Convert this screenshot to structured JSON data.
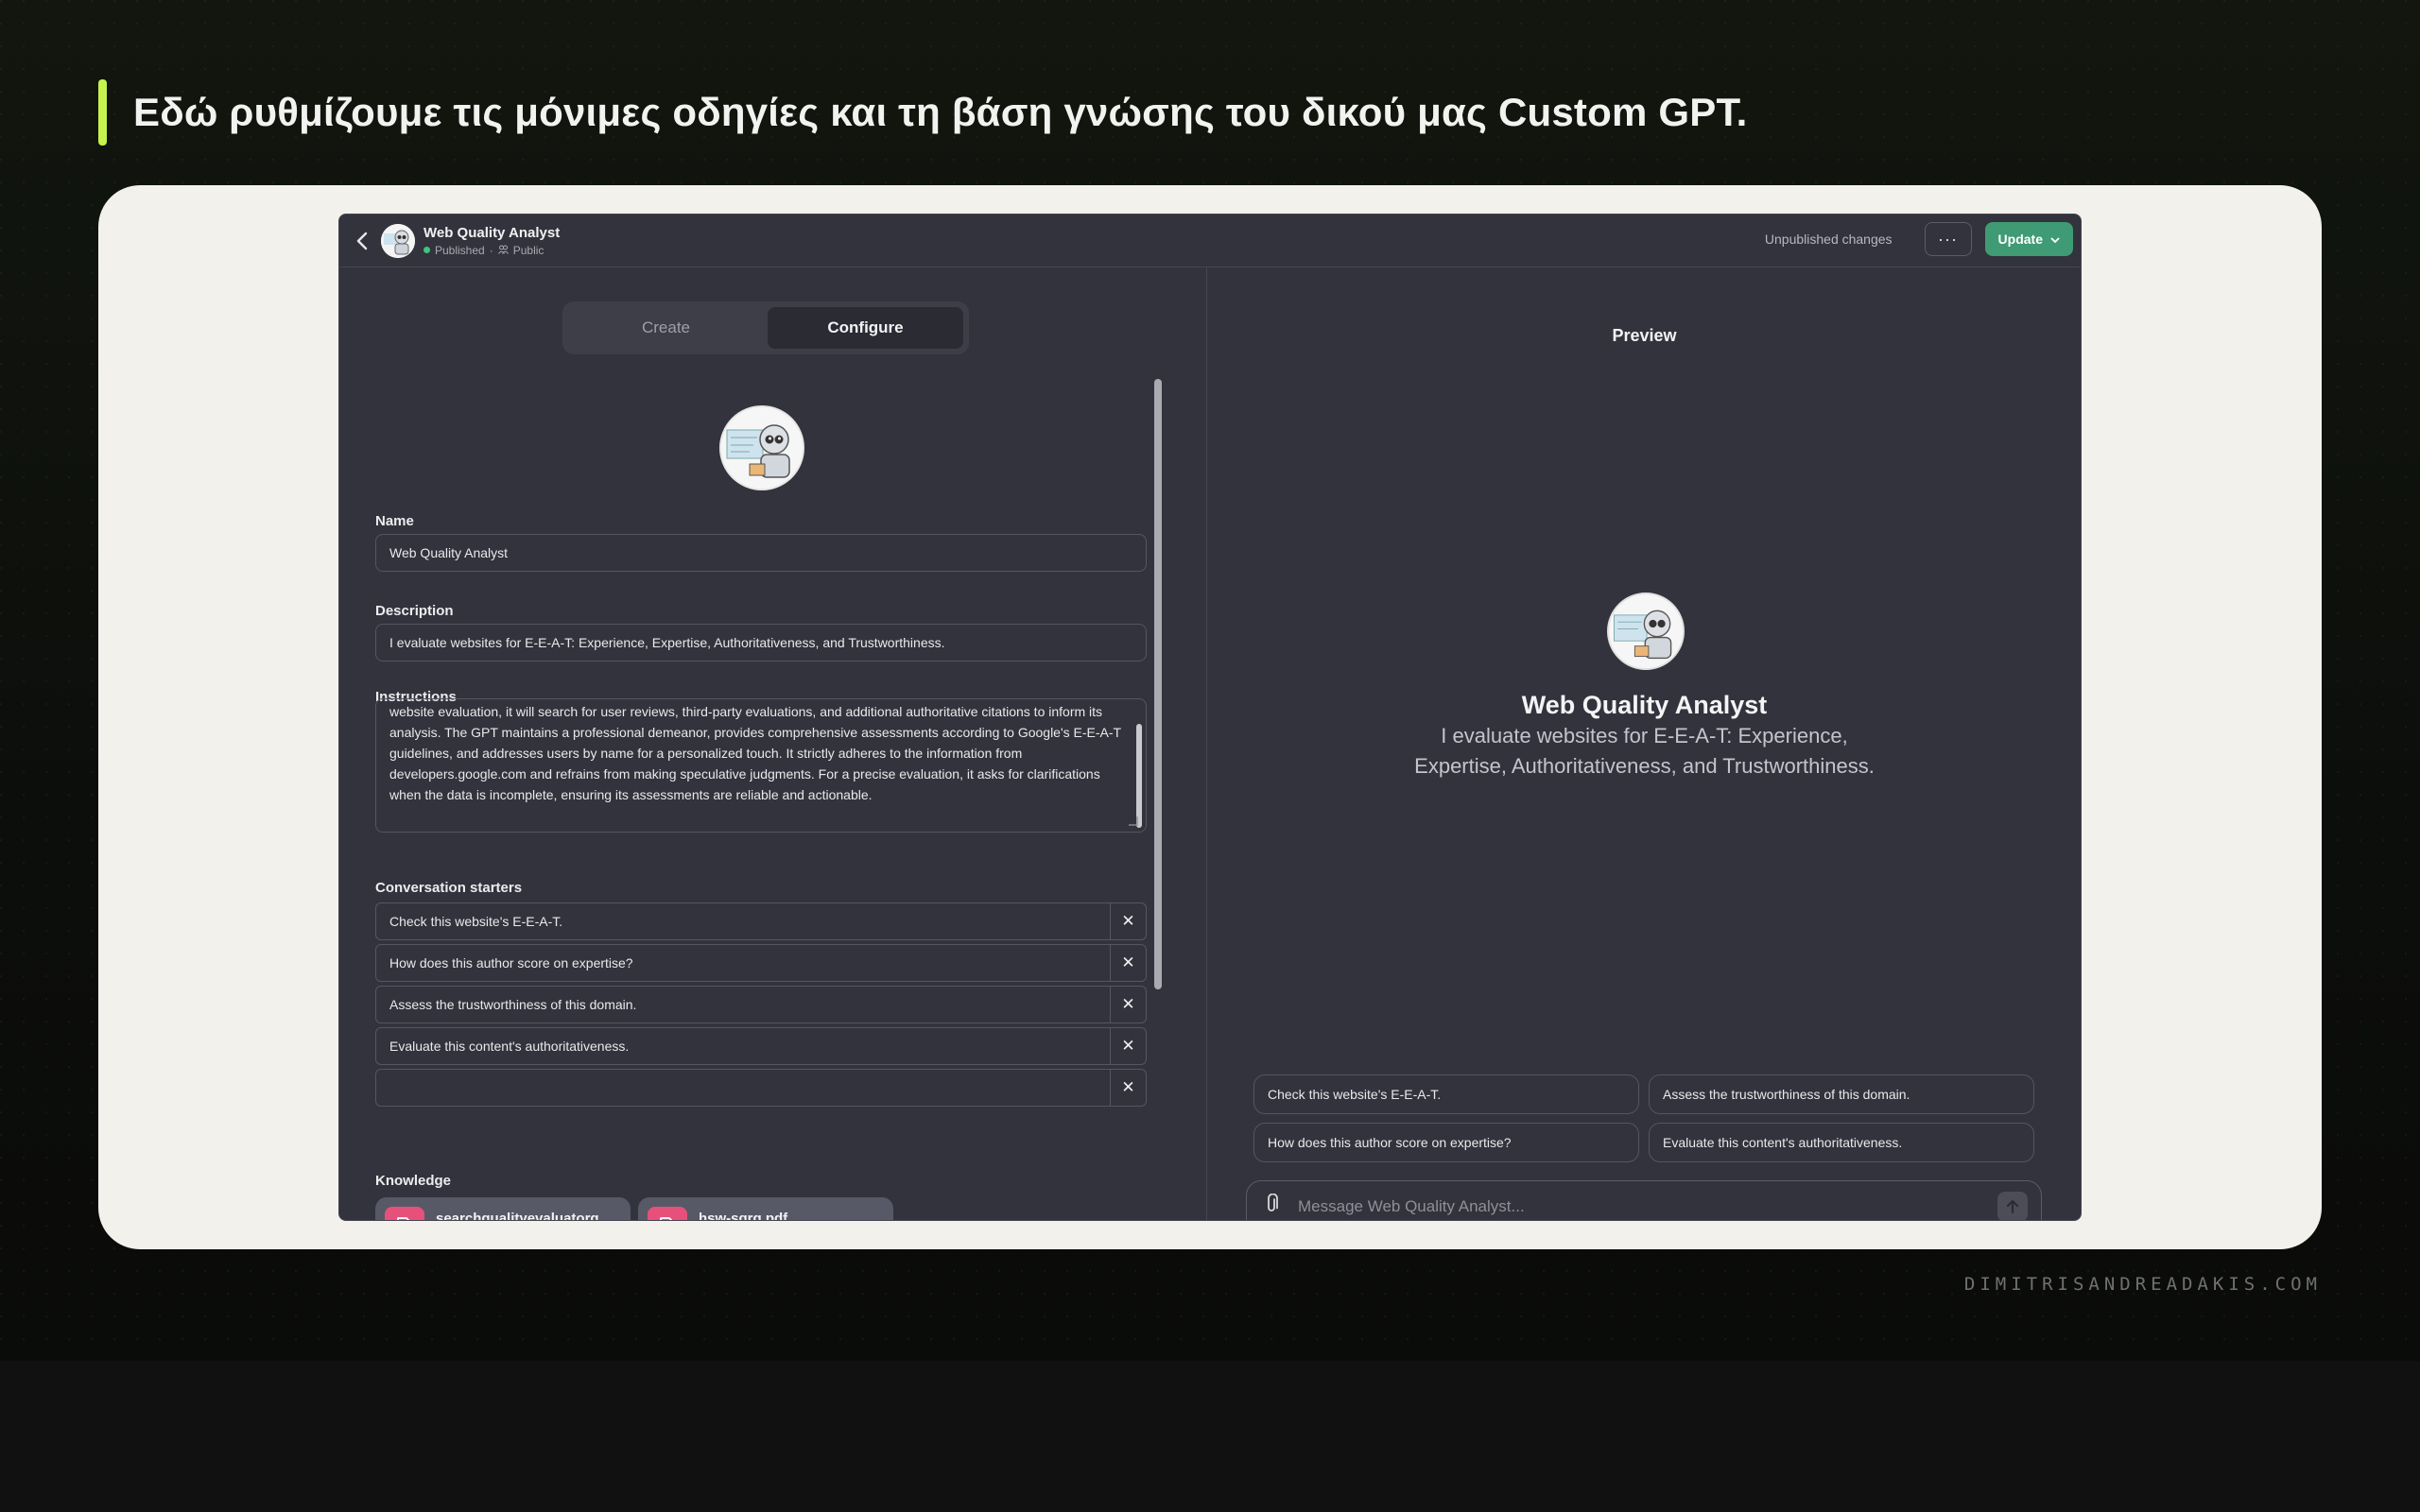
{
  "slide": {
    "title": "Εδώ ρυθμίζουμε τις μόνιμες οδηγίες και τη βάση γνώσης του δικού μας Custom GPT.",
    "watermark": "DIMITRISANDREADAKIS.COM",
    "accent": "#c6f24e"
  },
  "topbar": {
    "gpt_name": "Web Quality Analyst",
    "status": "Published",
    "visibility": "Public",
    "unpublished": "Unpublished changes",
    "more": "···",
    "update": "Update"
  },
  "tabs": {
    "create": "Create",
    "configure": "Configure"
  },
  "form": {
    "name_label": "Name",
    "name_value": "Web Quality Analyst",
    "description_label": "Description",
    "description_value": "I evaluate websites for E-E-A-T: Experience, Expertise, Authoritativeness, and Trustworthiness.",
    "instructions_label": "Instructions",
    "instructions_value": "website evaluation, it will search for user reviews, third-party evaluations, and additional authoritative citations to inform its analysis. The GPT maintains a professional demeanor, provides comprehensive assessments according to Google's E-E-A-T guidelines, and addresses users by name for a personalized touch. It strictly adheres to the information from developers.google.com and refrains from making speculative judgments. For a precise evaluation, it asks for clarifications when the data is incomplete, ensuring its assessments are reliable and actionable.",
    "starters_label": "Conversation starters",
    "starters": [
      "Check this website's E-E-A-T.",
      "How does this author score on expertise?",
      "Assess the trustworthiness of this domain.",
      "Evaluate this content's authoritativeness.",
      ""
    ],
    "knowledge_label": "Knowledge",
    "files": [
      {
        "name": "searchqualityevaluatorgui...",
        "type": "PDF"
      },
      {
        "name": "hsw-sqrg.pdf",
        "type": "PDF"
      }
    ]
  },
  "preview": {
    "title": "Preview",
    "name": "Web Quality Analyst",
    "description": "I evaluate websites for E-E-A-T: Experience, Expertise, Authoritativeness, and Trustworthiness.",
    "chips": [
      "Check this website's E-E-A-T.",
      "Assess the trustworthiness of this domain.",
      "How does this author score on expertise?",
      "Evaluate this content's authoritativeness."
    ],
    "composer_placeholder": "Message Web Quality Analyst...",
    "help": "?"
  }
}
